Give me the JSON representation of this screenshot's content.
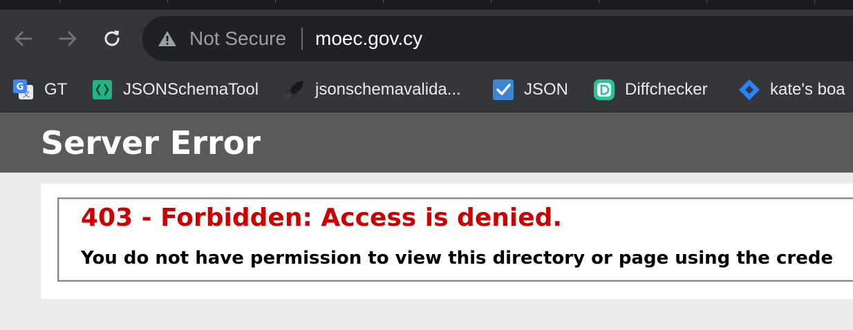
{
  "browser": {
    "toolbar": {
      "back_icon": "arrow-left-icon",
      "forward_icon": "arrow-right-icon",
      "reload_icon": "reload-icon",
      "security_label": "Not Secure",
      "url": "moec.gov.cy"
    },
    "bookmarks": [
      {
        "label": "GT",
        "icon": "google-translate-icon"
      },
      {
        "label": "JSONSchemaTool",
        "icon": "code-braces-icon"
      },
      {
        "label": "jsonschemavalida...",
        "icon": "rocket-icon"
      },
      {
        "label": "JSON",
        "icon": "checkbox-icon"
      },
      {
        "label": "Diffchecker",
        "icon": "diffchecker-icon"
      },
      {
        "label": "kate's boa",
        "icon": "jira-icon"
      }
    ]
  },
  "page": {
    "header_title": "Server Error",
    "error_title": "403 - Forbidden: Access is denied.",
    "error_message": "You do not have permission to view this directory or page using the crede"
  },
  "colors": {
    "error_red": "#cc0000",
    "header_bg": "#5a5a5a",
    "chrome_bg": "#35363a",
    "omnibox_bg": "#202124"
  }
}
